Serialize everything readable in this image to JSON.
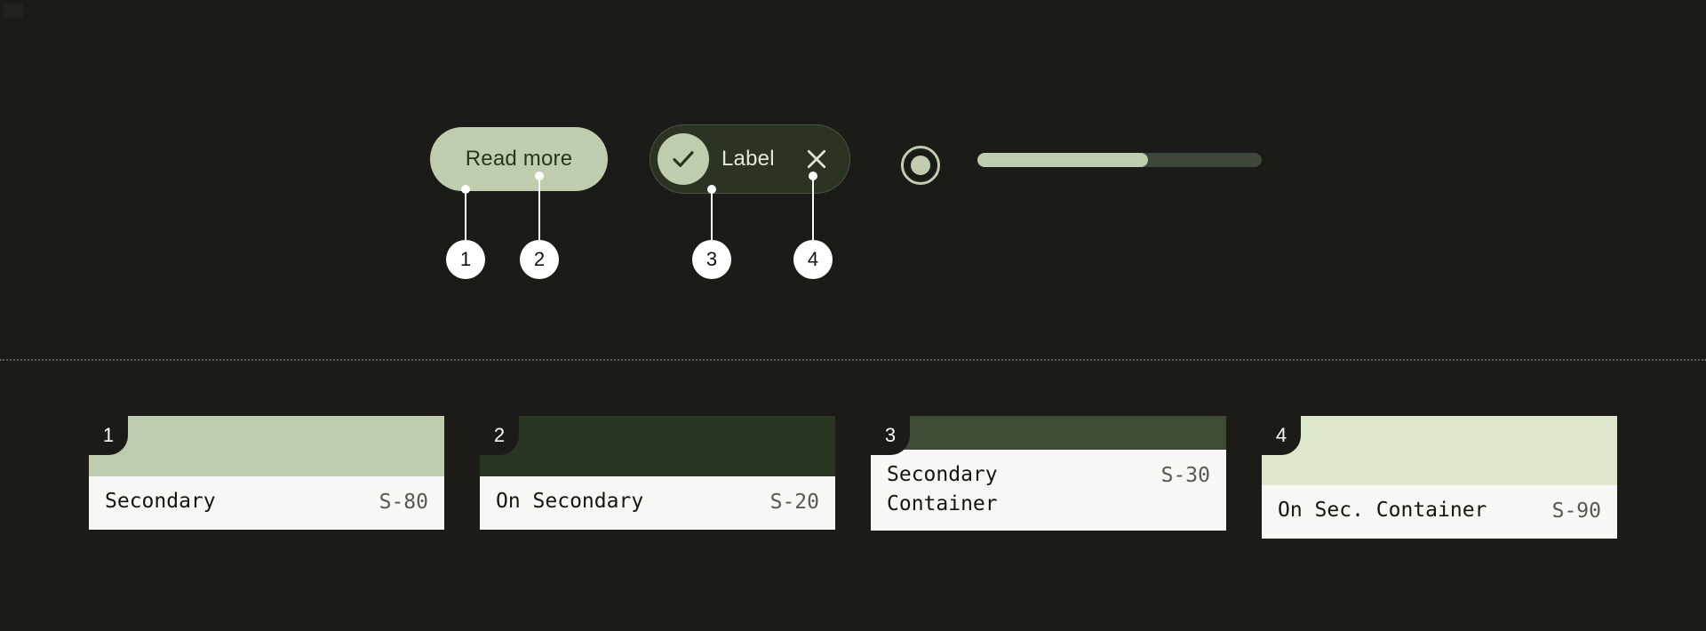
{
  "palette": {
    "background": "#1b1c18",
    "secondary": "#bfcdae",
    "on_secondary": "#2a3522",
    "secondary_container": "#404b35",
    "on_secondary_container": "#dce7cb",
    "surface_card": "#f7f7f5",
    "callout_fill": "#ffffff",
    "slider_track": "#3f463a",
    "chip_border": "#4c5644"
  },
  "components": {
    "button": {
      "label": "Read more",
      "icon": "none"
    },
    "chip": {
      "label": "Label",
      "leading_icon": "check-icon",
      "trailing_icon": "close-icon"
    },
    "radio": {
      "icon": "radio-selected-icon",
      "state": "selected"
    },
    "slider": {
      "icon": "slider-track",
      "value_percent": 60
    }
  },
  "callouts": [
    {
      "number": "1"
    },
    {
      "number": "2"
    },
    {
      "number": "3"
    },
    {
      "number": "4"
    }
  ],
  "cards": [
    {
      "badge": "1",
      "name": "Secondary",
      "token": "S-80",
      "swatch": "#bfcdae",
      "swatch_height": 68,
      "body_height": 60
    },
    {
      "badge": "2",
      "name": "On Secondary",
      "token": "S-20",
      "swatch": "#2a3522",
      "swatch_height": 68,
      "body_height": 60
    },
    {
      "badge": "3",
      "name": "Secondary\nContainer",
      "token": "S-30",
      "swatch": "#404b35",
      "swatch_height": 38,
      "body_height": 90
    },
    {
      "badge": "4",
      "name": "On Sec. Container",
      "token": "S-90",
      "swatch": "#dce7cb",
      "swatch_height": 78,
      "body_height": 50
    }
  ]
}
